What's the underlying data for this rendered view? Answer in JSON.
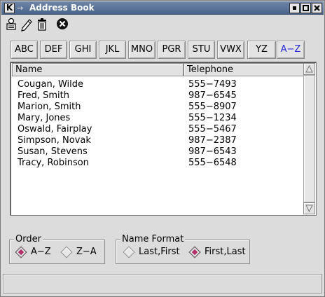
{
  "window": {
    "title": "Address Book",
    "app_icon_letter": "K",
    "title_icon": "pin-icon"
  },
  "toolbar": {
    "buttons": [
      {
        "name": "new-entry-button",
        "icon": "person-card-icon"
      },
      {
        "name": "edit-entry-button",
        "icon": "pencil-icon"
      },
      {
        "name": "delete-entry-button",
        "icon": "trash-icon"
      },
      {
        "name": "close-book-button",
        "icon": "stop-icon"
      }
    ]
  },
  "tabs": [
    {
      "label": "ABC"
    },
    {
      "label": "DEF"
    },
    {
      "label": "GHI"
    },
    {
      "label": "JKL"
    },
    {
      "label": "MNO"
    },
    {
      "label": "PGR"
    },
    {
      "label": "STU"
    },
    {
      "label": "VWX"
    },
    {
      "label": "YZ"
    },
    {
      "label": "A−Z"
    }
  ],
  "active_tab": "A−Z",
  "list": {
    "columns": [
      "Name",
      "Telephone"
    ],
    "rows": [
      {
        "name": "Cougan, Wilde",
        "phone": "555−7493"
      },
      {
        "name": "Fred, Smith",
        "phone": "987−6545"
      },
      {
        "name": "Marion, Smith",
        "phone": "555−8907"
      },
      {
        "name": "Mary, Jones",
        "phone": "555−1234"
      },
      {
        "name": "Oswald, Fairplay",
        "phone": "555−5467"
      },
      {
        "name": "Simpson, Novak",
        "phone": "987−2387"
      },
      {
        "name": "Susan, Stevens",
        "phone": "987−6543"
      },
      {
        "name": "Tracy, Robinson",
        "phone": "555−6548"
      }
    ]
  },
  "order": {
    "title": "Order",
    "options": [
      {
        "label": "A−Z",
        "checked": true
      },
      {
        "label": "Z−A",
        "checked": false
      }
    ]
  },
  "name_format": {
    "title": "Name Format",
    "options": [
      {
        "label": "Last,First",
        "checked": false
      },
      {
        "label": "First,Last",
        "checked": true
      }
    ]
  },
  "colors": {
    "titlebar": "#5a7196",
    "active_tab_text": "#2626d8",
    "radio_checked": "#b0306a"
  }
}
